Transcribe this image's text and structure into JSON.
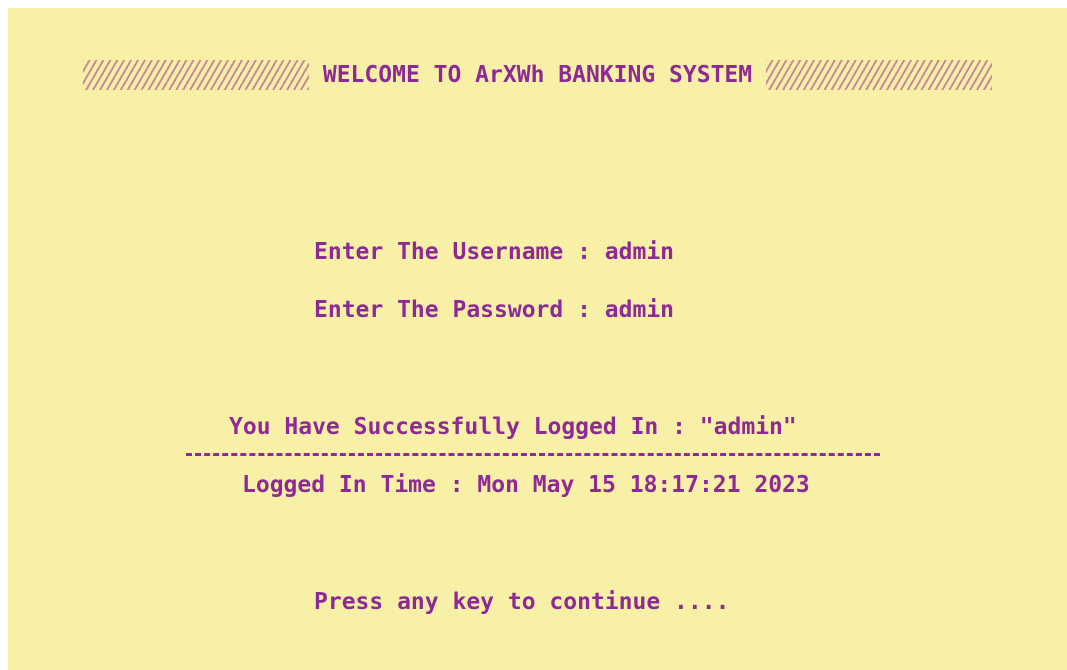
{
  "banner": {
    "title": "WELCOME TO ArXWh BANKING SYSTEM"
  },
  "login": {
    "username_prompt": "Enter The Username : admin",
    "password_prompt": "Enter The Password : admin"
  },
  "result": {
    "success_message": "You Have Successfully Logged In : \"admin\"",
    "time_message": "Logged In Time : Mon May 15 18:17:21 2023"
  },
  "footer": {
    "continue_prompt": "Press any key to continue ...."
  },
  "colors": {
    "background": "#f8f0a6",
    "text": "#8e2a96",
    "hatch": "#c98a96"
  }
}
